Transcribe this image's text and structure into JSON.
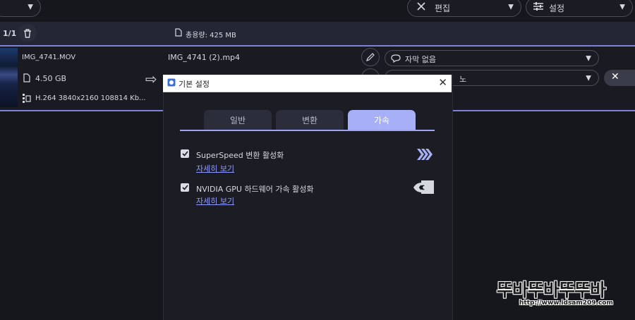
{
  "top": {
    "edit_label": "편집",
    "settings_label": "설정"
  },
  "toolbar": {
    "page_count": "1/1",
    "total_size": "총용량: 425 MB"
  },
  "file": {
    "source_name": "IMG_4741.MOV",
    "source_size": "4.50 GB",
    "source_info": "H.264 3840x2160 108814 Kb...",
    "output_name": "IMG_4741 (2).mp4",
    "subtitle_option": "자막 없음",
    "audio_option_partial": "노"
  },
  "dialog": {
    "title": "기본 설정",
    "tabs": [
      {
        "label": "일반",
        "active": false
      },
      {
        "label": "변환",
        "active": false
      },
      {
        "label": "가속",
        "active": true
      }
    ],
    "options": [
      {
        "label": "SuperSpeed 변환 활성화",
        "checked": true,
        "link": "자세히 보기",
        "icon": "superspeed-icon"
      },
      {
        "label": "NVIDIA GPU 하드웨어 가속 활성화",
        "checked": true,
        "link": "자세히 보기",
        "icon": "nvidia-icon"
      }
    ]
  },
  "watermark": {
    "brand": "뚜바뚜바뚜뚜바",
    "url": "http://www.idsam209.com"
  },
  "colors": {
    "accent": "#a7aff6",
    "background": "#16171d",
    "link": "#8e9bff"
  }
}
